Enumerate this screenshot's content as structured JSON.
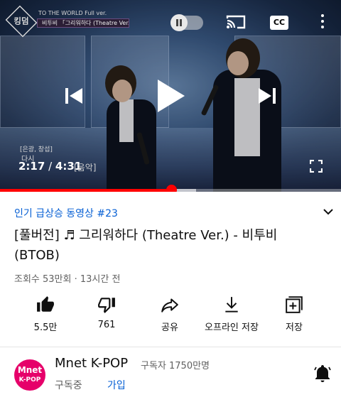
{
  "player": {
    "logo_text": "킹덤",
    "banner_small": "TO THE WORLD Full ver.",
    "banner_text": "비투비 「그리워하다 (Theatre Ver.)」",
    "caption_line1": "[은광, 창섭]",
    "caption_line2": "다시",
    "time_current": "2:17",
    "time_separator": " / ",
    "time_total": "4:31",
    "sound_caption": "[음악]",
    "cc_label": "CC",
    "played_fraction": 0.504,
    "buffered_fraction": 0.575
  },
  "video": {
    "trending_label": "인기 급상승 동영상 #23",
    "title": "[풀버전] ♬ 그리워하다 (Theatre Ver.) - 비투비 (BTOB)",
    "meta": "조회수 53만회 · 13시간 전"
  },
  "actions": {
    "like": "5.5만",
    "dislike": "761",
    "share": "공유",
    "download": "오프라인 저장",
    "save": "저장"
  },
  "channel": {
    "avatar_line1": "Mnet",
    "avatar_line2": "K-POP",
    "name": "Mnet K-POP",
    "subscribers": "구독자 1750만명",
    "subscribed_label": "구독중",
    "join_label": "가입"
  },
  "colors": {
    "accent_red": "#ff0000",
    "link_blue": "#065fd4",
    "avatar_pink": "#e6006a"
  },
  "icons": [
    "skip-previous-icon",
    "play-icon",
    "skip-next-icon",
    "cast-icon",
    "more-vert-icon",
    "fullscreen-icon",
    "chevron-down-icon",
    "thumb-up-icon",
    "thumb-down-icon",
    "share-icon",
    "download-icon",
    "playlist-add-icon",
    "bell-icon",
    "pause-icon"
  ]
}
